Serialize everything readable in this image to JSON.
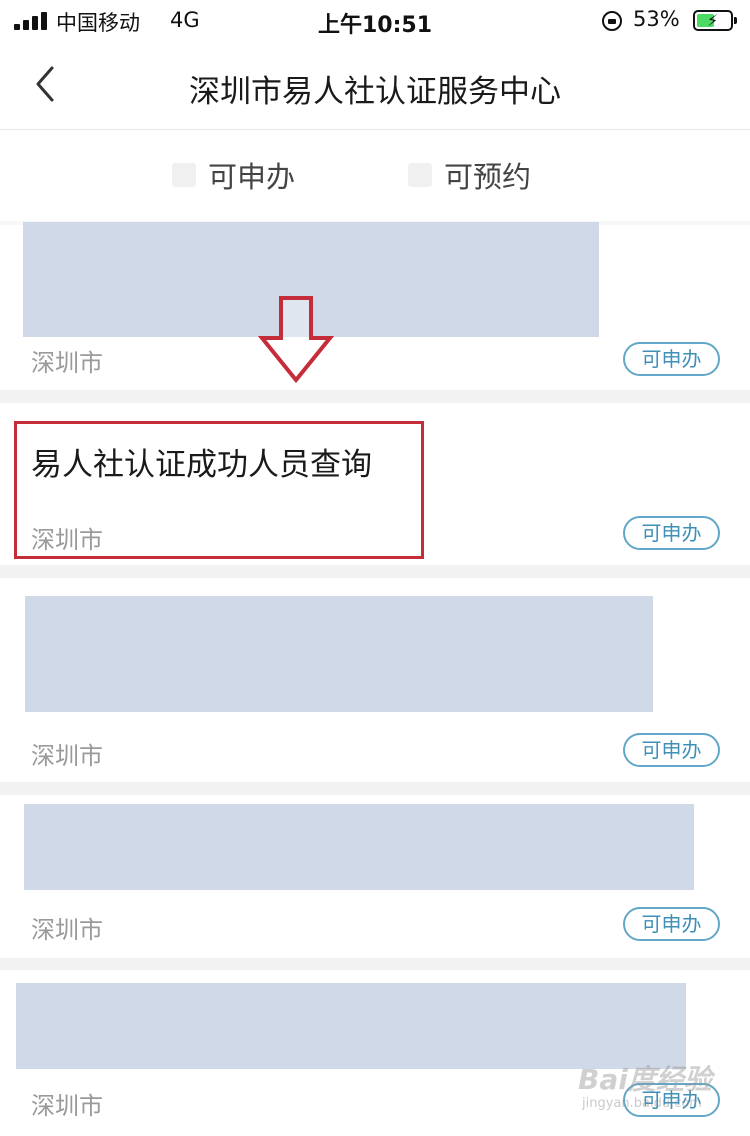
{
  "status_bar": {
    "carrier": "中国移动",
    "network": "4G",
    "time": "上午10:51",
    "battery_percent": "53%",
    "battery_level": 0.53,
    "charging": true
  },
  "nav": {
    "back_icon": "chevron-left-icon",
    "title": "深圳市易人社认证服务中心"
  },
  "filters": [
    {
      "label": "可申办",
      "checked": false
    },
    {
      "label": "可预约",
      "checked": false
    }
  ],
  "items": [
    {
      "title": "",
      "location": "深圳市",
      "badge": "可申办",
      "redacted": true
    },
    {
      "title": "易人社认证成功人员查询",
      "location": "深圳市",
      "badge": "可申办",
      "redacted": false
    },
    {
      "title": "",
      "location": "深圳市",
      "badge": "可申办",
      "redacted": true
    },
    {
      "title": "",
      "location": "深圳市",
      "badge": "可申办",
      "redacted": true
    },
    {
      "title": "",
      "location": "深圳市",
      "badge": "可申办",
      "redacted": true
    }
  ],
  "annotations": {
    "arrow_icon": "arrow-down-icon",
    "highlight_color": "#c62d3a",
    "arrow_color": "#c62d3a"
  },
  "watermark": {
    "text": "Bai度经验",
    "sub": "jingyan.baidu.com"
  },
  "colors": {
    "badge_border": "#62a7c7",
    "badge_text": "#3f8fb8",
    "redaction": "#d0d9e8"
  }
}
